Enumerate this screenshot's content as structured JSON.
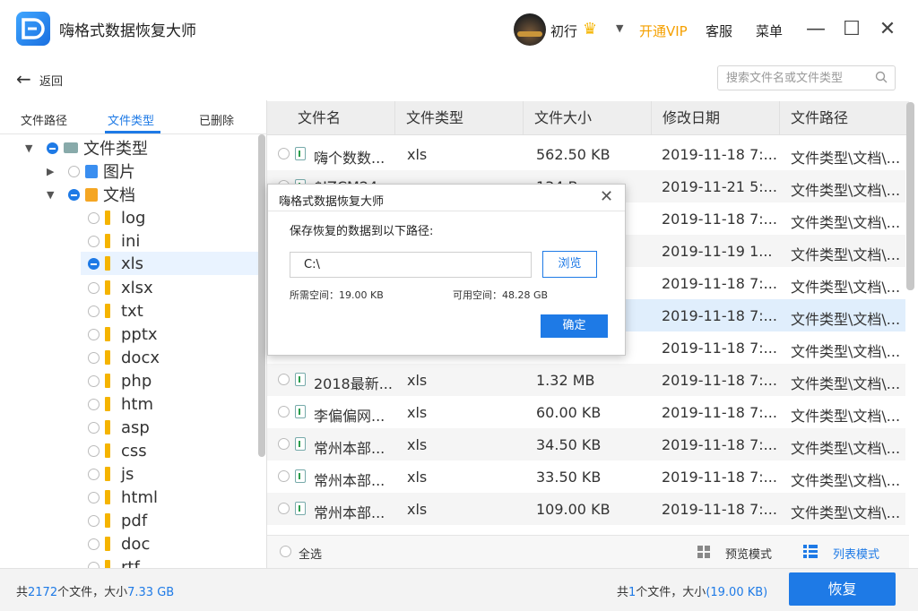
{
  "app": {
    "title": "嗨格式数据恢复大师",
    "username": "初行",
    "vip_label": "开通VIP",
    "service_label": "客服",
    "menu_label": "菜单",
    "accent_color": "#1e7ae6",
    "vip_color": "#f5a000"
  },
  "nav": {
    "back_label": "返回",
    "search_placeholder": "搜索文件名或文件类型"
  },
  "tabs": [
    {
      "label": "文件路径",
      "active": false
    },
    {
      "label": "文件类型",
      "active": true
    },
    {
      "label": "已删除",
      "active": false
    }
  ],
  "tree": {
    "root": "文件类型",
    "images": "图片",
    "docs": "文档",
    "doc_types": [
      "log",
      "ini",
      "xls",
      "xlsx",
      "txt",
      "pptx",
      "docx",
      "php",
      "htm",
      "asp",
      "css",
      "js",
      "html",
      "pdf",
      "doc",
      "rtf"
    ],
    "selected": "xls"
  },
  "table": {
    "columns": [
      "文件名",
      "文件类型",
      "文件大小",
      "修改日期",
      "文件路径"
    ],
    "rows": [
      {
        "name": "嗨个数数...",
        "type": "xls",
        "size": "562.50 KB",
        "date": "2019-11-18 7:...",
        "path": "文件类型\\文档\\..."
      },
      {
        "name": "$IZCM24...",
        "type": "",
        "size": "134 B",
        "date": "2019-11-21 5:...",
        "path": "文件类型\\文档\\..."
      },
      {
        "name": "",
        "type": "",
        "size": "",
        "date": "2019-11-18 7:...",
        "path": "文件类型\\文档\\..."
      },
      {
        "name": "",
        "type": "",
        "size": "",
        "date": "2019-11-19 1...",
        "path": "文件类型\\文档\\..."
      },
      {
        "name": "",
        "type": "",
        "size": "",
        "date": "2019-11-18 7:...",
        "path": "文件类型\\文档\\..."
      },
      {
        "name": "",
        "type": "",
        "size": "",
        "date": "2019-11-18 7:...",
        "path": "文件类型\\文档\\..."
      },
      {
        "name": "",
        "type": "",
        "size": "",
        "date": "2019-11-18 7:...",
        "path": "文件类型\\文档\\..."
      },
      {
        "name": "2018最新...",
        "type": "xls",
        "size": "1.32 MB",
        "date": "2019-11-18 7:...",
        "path": "文件类型\\文档\\..."
      },
      {
        "name": "李偏偏网...",
        "type": "xls",
        "size": "60.00 KB",
        "date": "2019-11-18 7:...",
        "path": "文件类型\\文档\\..."
      },
      {
        "name": "常州本部...",
        "type": "xls",
        "size": "34.50 KB",
        "date": "2019-11-18 7:...",
        "path": "文件类型\\文档\\..."
      },
      {
        "name": "常州本部...",
        "type": "xls",
        "size": "33.50 KB",
        "date": "2019-11-18 7:...",
        "path": "文件类型\\文档\\..."
      },
      {
        "name": "常州本部...",
        "type": "xls",
        "size": "109.00 KB",
        "date": "2019-11-18 7:...",
        "path": "文件类型\\文档\\..."
      }
    ]
  },
  "bottom": {
    "select_all": "全选",
    "preview_mode": "预览模式",
    "list_mode": "列表模式"
  },
  "footer": {
    "total_prefix": "共",
    "total_count": "2172",
    "total_mid": "个文件，大小",
    "total_size": "7.33 GB",
    "sel_prefix": "共",
    "sel_count": "1",
    "sel_mid": "个文件，大小",
    "sel_size": "(19.00 KB)",
    "recover_label": "恢复"
  },
  "dialog": {
    "title": "嗨格式数据恢复大师",
    "prompt": "保存恢复的数据到以下路径:",
    "path_value": "C:\\",
    "browse_label": "浏览",
    "required_space": "所需空间：19.00 KB",
    "available_space": "可用空间：48.28 GB",
    "ok_label": "确定"
  }
}
